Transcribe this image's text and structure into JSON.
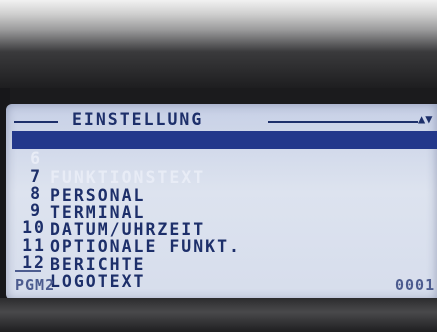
{
  "header": {
    "title": "EINSTELLUNG",
    "scroll_arrow": "▲▼"
  },
  "menu": {
    "items": [
      {
        "number": "6",
        "label": "FUNKTIONSTEXT"
      },
      {
        "number": "7",
        "label": "PERSONAL"
      },
      {
        "number": "8",
        "label": "TERMINAL"
      },
      {
        "number": "9",
        "label": "DATUM/UHRZEIT"
      },
      {
        "number": "10",
        "label": "OPTIONALE FUNKT."
      },
      {
        "number": "11",
        "label": "BERICHTE"
      },
      {
        "number": "12",
        "label": "LOGOTEXT"
      }
    ],
    "selected_index": 0
  },
  "footer": {
    "mode": "PGM2",
    "counter": "0001"
  },
  "colors": {
    "lcd_text": "#1d2f6a",
    "selection": "#23388b",
    "lcd_background": "#d6ddec"
  }
}
